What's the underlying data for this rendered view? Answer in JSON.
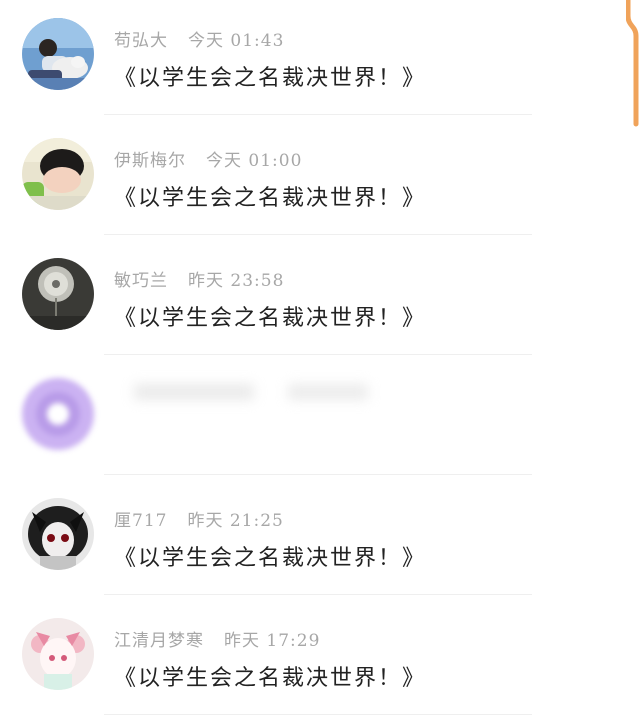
{
  "messages": [
    {
      "name": "苟弘大",
      "time": "今天 01:43",
      "text": "《以学生会之名裁决世界！》",
      "avatar": "boy-with-dog-photo"
    },
    {
      "name": "伊斯梅尔",
      "time": "今天 01:00",
      "text": "《以学生会之名裁决世界！》",
      "avatar": "sleeping-boy-photo"
    },
    {
      "name": "敏巧兰",
      "time": "昨天 23:58",
      "text": "《以学生会之名裁决世界！》",
      "avatar": "dandelion-photo"
    },
    {
      "name": "",
      "time": "",
      "text": "",
      "avatar": "pixelated-purple-avatar",
      "redacted": true
    },
    {
      "name": "厘717",
      "time": "昨天 21:25",
      "text": "《以学生会之名裁决世界！》",
      "avatar": "anime-character-dark-art"
    },
    {
      "name": "江清月梦寒",
      "time": "昨天 17:29",
      "text": "《以学生会之名裁决世界！》",
      "avatar": "anime-character-pink-art"
    }
  ],
  "colors": {
    "name": "#a7a7a7",
    "text": "#222222",
    "divider": "#efefef",
    "scroll_indicator": "#f0a35a"
  }
}
